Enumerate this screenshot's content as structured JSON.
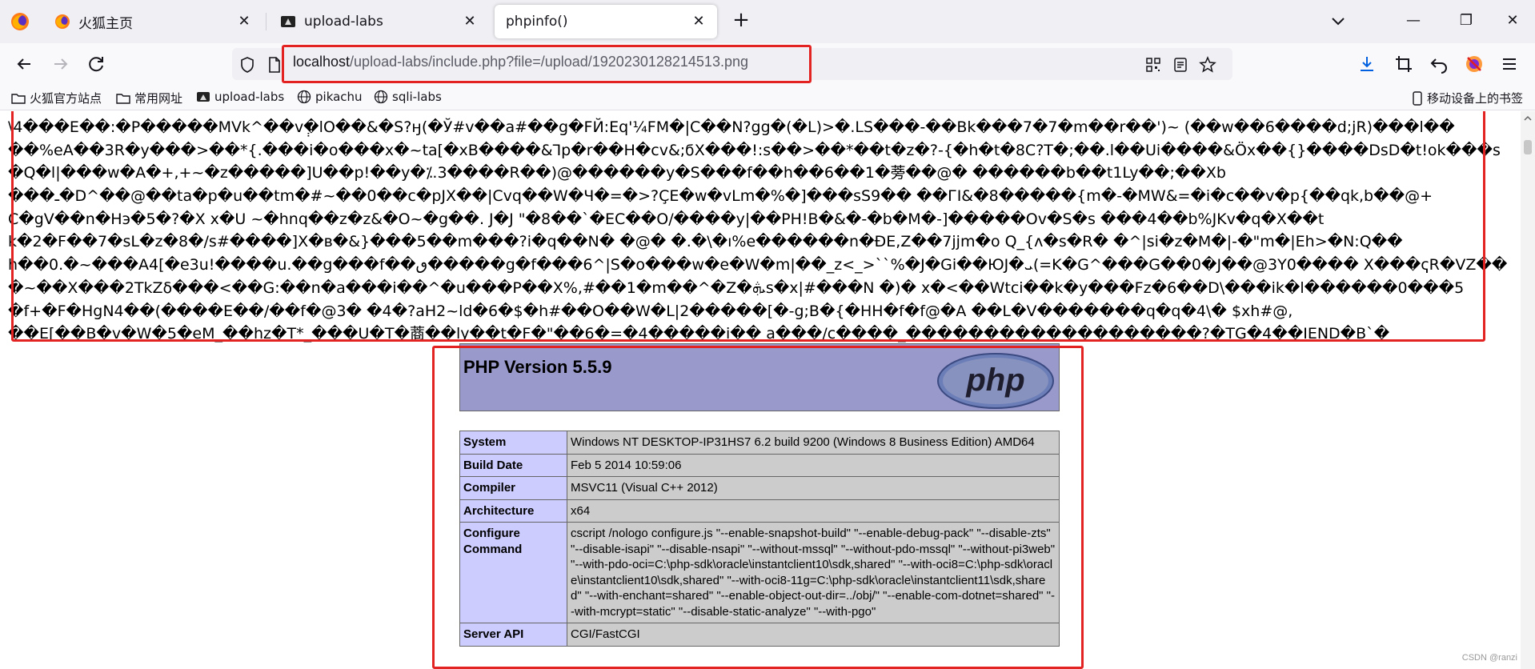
{
  "browser": {
    "tabs": [
      {
        "label": "火狐主页",
        "icon": "firefox-icon",
        "active": false
      },
      {
        "label": "upload-labs",
        "icon": "upload-labs-icon",
        "active": false
      },
      {
        "label": "phpinfo()",
        "icon": "",
        "active": true
      }
    ],
    "url": {
      "host": "localhost",
      "path": "/upload-labs/include.php?file=/upload/1920230128214513.png"
    },
    "bookmarks": [
      {
        "label": "火狐官方站点",
        "icon": "folder-icon"
      },
      {
        "label": "常用网址",
        "icon": "folder-icon"
      },
      {
        "label": "upload-labs",
        "icon": "upload-labs-icon"
      },
      {
        "label": "pikachu",
        "icon": "globe-icon"
      },
      {
        "label": "sqli-labs",
        "icon": "globe-icon"
      }
    ],
    "mobile_bookmarks": "移动设备上的书签"
  },
  "garbage_lines": [
    "\\4���E��:�P�����MVk^��v݄�lO��&�S?ӈ(�Ў#v��a#��g�FЙ:Eq'¼FM�|C��N?gց�(�L)>�.LS���-��Bk���7�7�m��r��')~ (��w��6����d;jR)���l��",
    "��%eA��3R�y���>��*{.���i�o���x�~ta[�xB����&Ꞁp�r��H�cv&;ϭX���!:s��>��*��t�z�?-{�h�t�8C?T�;��.l��Ui����&Öx��{}����DsD�t!ok���s",
    "�Q�l|���w�A�+,+~�z�����]U��p!��y�⁒.3����R��)@������y�S���f��h��6��1�蒡��@� ������b��t1Ly��;��Xb",
    "���ـ�D^��@��ta�p�u��tm�#~��0��c�pJX��|Cvq��W�Ч�=�>?ÇE�w�vLm�%�]���sS9�� ��ГI&�8�����{m�-�MW&=�i�c��v�p{��qk,b��@+",
    "C�gV��n�Hэ�5�?�X x�U ~�hnq��z�z&�O~�g��. J�J \"�8��`�EC��O/����y|��PH!B�&�-�b�M�-]�����Ov�S�s ���4��b%JKv�q�X��t",
    "k�2�F��7�sL�z�8�/s#����]X�в�&}���5��m���?i�q��N� �@� �.�\\�ı%e������n�ĐE,Z��7jjm�o Q_{ʌ�s�R� �^|si�z�M�|-�\"m�|Eh>�N:Q��",
    "h��0.�~���A4[�e3u!����u.��g���f��ٯ�����g�f���6^|S�o���w�e�W�m|��_z<_>``%�J�Gi��ЮJ�ܝ(=K�G^���G��0�J��@3Y0���� X���ҁR�VZ��",
    "�~��X���2TkZδ���<��G:��n�a���i��^�u���P��X%,#��1�m��^�Z�ܞs�x|#���N �)� x�<��Wtci��k�y���Fz�6��D\\���ik�l������0���5",
    "�f+�F�HgN4��(����E��/��f�@3� �4�?aH2~ld�6�$�h#��O��W�L|2�����[�-g;B�{�HH�f�f@�A ��L�V�������q�q�4\\� $xh#@,",
    "��E[��B�v�W�5�eM_��hz�T*_���U�T�蔏��ly��t�F�\"��6�=�4�����i�� a���/c����_�������������������?�TG�4��IEND�B`�"
  ],
  "phpinfo": {
    "title": "PHP Version 5.5.9",
    "logo_text": "php",
    "rows": [
      {
        "key": "System",
        "value": "Windows NT DESKTOP-IP31HS7 6.2 build 9200 (Windows 8 Business Edition) AMD64"
      },
      {
        "key": "Build Date",
        "value": "Feb 5 2014 10:59:06"
      },
      {
        "key": "Compiler",
        "value": "MSVC11 (Visual C++ 2012)"
      },
      {
        "key": "Architecture",
        "value": "x64"
      },
      {
        "key": "Configure Command",
        "value": "cscript /nologo configure.js \"--enable-snapshot-build\" \"--enable-debug-pack\" \"--disable-zts\" \"--disable-isapi\" \"--disable-nsapi\" \"--without-mssql\" \"--without-pdo-mssql\" \"--without-pi3web\" \"--with-pdo-oci=C:\\php-sdk\\oracle\\instantclient10\\sdk,shared\" \"--with-oci8=C:\\php-sdk\\oracle\\instantclient10\\sdk,shared\" \"--with-oci8-11g=C:\\php-sdk\\oracle\\instantclient11\\sdk,shared\" \"--with-enchant=shared\" \"--enable-object-out-dir=../obj/\" \"--enable-com-dotnet=shared\" \"--with-mcrypt=static\" \"--disable-static-analyze\" \"--with-pgo\""
      },
      {
        "key": "Server API",
        "value": "CGI/FastCGI"
      }
    ]
  },
  "watermark": "CSDN @ranzi"
}
